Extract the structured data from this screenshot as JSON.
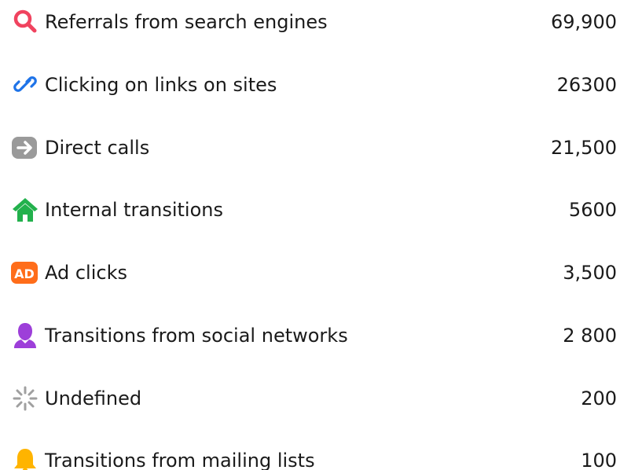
{
  "traffic_sources": [
    {
      "icon": "search-icon",
      "label": "Referrals from search engines",
      "value": "69,900",
      "color": "#f0435f"
    },
    {
      "icon": "link-icon",
      "label": "Clicking on links on sites",
      "value": "26300",
      "color": "#1e73e8"
    },
    {
      "icon": "arrow-right-icon",
      "label": "Direct calls",
      "value": "21,500",
      "color": "#9a9a9a"
    },
    {
      "icon": "home-icon",
      "label": "Internal transitions",
      "value": "5600",
      "color": "#22b14c"
    },
    {
      "icon": "ad-badge-icon",
      "label": "Ad clicks",
      "value": "3,500",
      "icon_text": "AD",
      "color": "#ff6d1a"
    },
    {
      "icon": "user-icon",
      "label": "Transitions from social networks",
      "value": "2 800",
      "color": "#9d3fd9"
    },
    {
      "icon": "spinner-icon",
      "label": "Undefined",
      "value": "200",
      "color": "#a0a0a0"
    },
    {
      "icon": "bell-icon",
      "label": "Transitions from mailing lists",
      "value": "100",
      "color": "#ffb400"
    }
  ]
}
